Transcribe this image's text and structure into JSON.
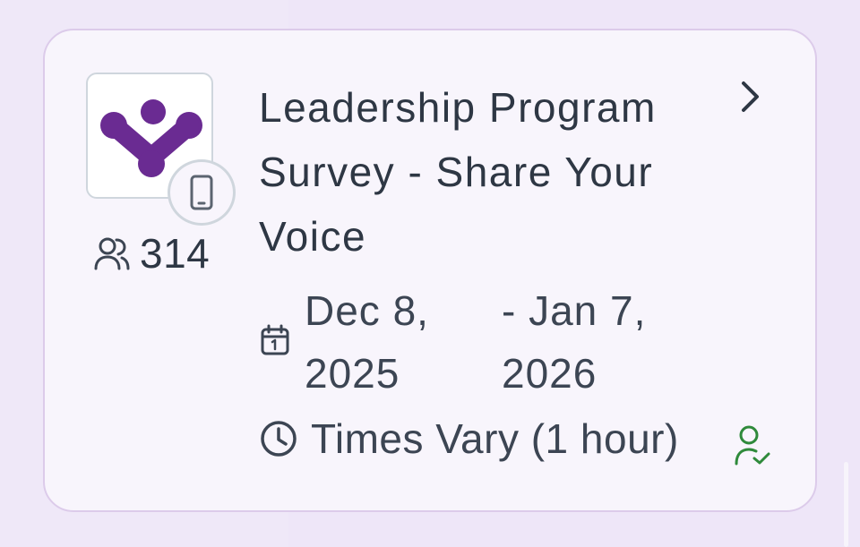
{
  "event": {
    "title": "Leadership Program Survey - Share Your Voice",
    "attendee_count": "314",
    "date_start": [
      "Dec 8,",
      "2025"
    ],
    "date_end": [
      "- Jan 7,",
      "2026"
    ],
    "time": "Times Vary (1 hour)"
  },
  "icons": {
    "logo": "organization-logo",
    "device": "mobile-phone-icon",
    "attendees": "users-icon",
    "calendar": "calendar-icon",
    "clock": "clock-icon",
    "chevron": "chevron-right-icon",
    "registered": "user-check-icon"
  },
  "colors": {
    "card_background": "#f8f5fc",
    "card_border": "#dccbea",
    "page_background": "#eee6f8",
    "text": "#2e3744",
    "logo_purple": "#6a2b92",
    "registered_green": "#2f8a3b"
  }
}
